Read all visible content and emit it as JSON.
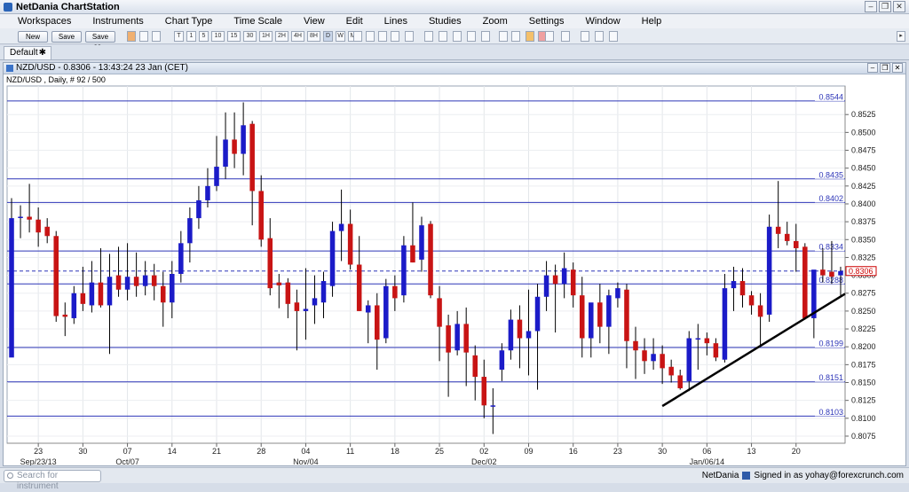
{
  "app": {
    "title": "NetDania ChartStation"
  },
  "menu": [
    "Workspaces",
    "Instruments",
    "Chart Type",
    "Time Scale",
    "View",
    "Edit",
    "Lines",
    "Studies",
    "Zoom",
    "Settings",
    "Window",
    "Help"
  ],
  "toolbar": {
    "new_label": "New",
    "save_label": "Save",
    "saveas_label": "Save as...",
    "timescales": [
      "T",
      "1",
      "5",
      "10",
      "15",
      "30",
      "1H",
      "2H",
      "4H",
      "8H",
      "D",
      "W",
      "M"
    ]
  },
  "tabs": [
    {
      "label": "Default"
    }
  ],
  "chart_window": {
    "title": "NZD/USD - 0.8306 - 13:43:24  23 Jan (CET)",
    "subtitle": "NZD/USD , Daily, # 92 / 500"
  },
  "statusbar": {
    "search_placeholder": "Search for instrument",
    "brand": "NetDania",
    "signed_in": "Signed in as yohay@forexcrunch.com"
  },
  "colors": {
    "up": "#1b1bc8",
    "down": "#c81414",
    "level_line": "#2e36b8",
    "trend_line": "#000000",
    "current_price": "#cc0000"
  },
  "chart_data": {
    "type": "candlestick",
    "symbol": "NZD/USD",
    "ylim": [
      0.807,
      0.856
    ],
    "yticks": [
      "0.8525",
      "0.8500",
      "0.8475",
      "0.8450",
      "0.8425",
      "0.8400",
      "0.8375",
      "0.8350",
      "0.8325",
      "0.8300",
      "0.8275",
      "0.8250",
      "0.8225",
      "0.8200",
      "0.8175",
      "0.8150",
      "0.8125",
      "0.8100",
      "0.8075"
    ],
    "xtick_labels": [
      {
        "i": 3,
        "top": "23",
        "bottom": "Sep/23/13"
      },
      {
        "i": 8,
        "top": "30",
        "bottom": ""
      },
      {
        "i": 13,
        "top": "07",
        "bottom": "Oct/07"
      },
      {
        "i": 18,
        "top": "14",
        "bottom": ""
      },
      {
        "i": 23,
        "top": "21",
        "bottom": ""
      },
      {
        "i": 28,
        "top": "28",
        "bottom": ""
      },
      {
        "i": 33,
        "top": "04",
        "bottom": "Nov/04"
      },
      {
        "i": 38,
        "top": "11",
        "bottom": ""
      },
      {
        "i": 43,
        "top": "18",
        "bottom": ""
      },
      {
        "i": 48,
        "top": "25",
        "bottom": ""
      },
      {
        "i": 53,
        "top": "02",
        "bottom": "Dec/02"
      },
      {
        "i": 58,
        "top": "09",
        "bottom": ""
      },
      {
        "i": 63,
        "top": "16",
        "bottom": ""
      },
      {
        "i": 68,
        "top": "23",
        "bottom": ""
      },
      {
        "i": 73,
        "top": "30",
        "bottom": ""
      },
      {
        "i": 78,
        "top": "06",
        "bottom": "Jan/06/14"
      },
      {
        "i": 83,
        "top": "13",
        "bottom": ""
      },
      {
        "i": 88,
        "top": "20",
        "bottom": ""
      }
    ],
    "hlines": [
      {
        "value": 0.8544,
        "label": "0.8544",
        "color": "#2e36b8"
      },
      {
        "value": 0.8435,
        "label": "0.8435",
        "color": "#2e36b8"
      },
      {
        "value": 0.8402,
        "label": "0.8402",
        "color": "#2e36b8"
      },
      {
        "value": 0.8334,
        "label": "0.8334",
        "color": "#2e36b8"
      },
      {
        "value": 0.8288,
        "label": "0.8288",
        "color": "#2e36b8"
      },
      {
        "value": 0.8199,
        "label": "0.8199",
        "color": "#2e36b8"
      },
      {
        "value": 0.8151,
        "label": "0.8151",
        "color": "#2e36b8"
      },
      {
        "value": 0.8103,
        "label": "0.8103",
        "color": "#2e36b8"
      }
    ],
    "current_price": {
      "value": 0.8306,
      "label": "0.8306"
    },
    "trendline": {
      "from": {
        "i": 73,
        "price": 0.8117
      },
      "to": {
        "i": 94,
        "price": 0.8278
      }
    },
    "candles": [
      [
        0.8185,
        0.8408,
        0.8208,
        0.838
      ],
      [
        0.8382,
        0.8398,
        0.8352,
        0.8382
      ],
      [
        0.8382,
        0.8428,
        0.836,
        0.8378
      ],
      [
        0.8378,
        0.8395,
        0.834,
        0.836
      ],
      [
        0.8368,
        0.838,
        0.8345,
        0.8355
      ],
      [
        0.8355,
        0.8362,
        0.8235,
        0.8243
      ],
      [
        0.8245,
        0.8262,
        0.8215,
        0.8242
      ],
      [
        0.824,
        0.8285,
        0.8232,
        0.8275
      ],
      [
        0.8275,
        0.8312,
        0.825,
        0.826
      ],
      [
        0.8258,
        0.832,
        0.8248,
        0.829
      ],
      [
        0.829,
        0.8338,
        0.8255,
        0.8258
      ],
      [
        0.8258,
        0.833,
        0.819,
        0.8298
      ],
      [
        0.83,
        0.834,
        0.827,
        0.828
      ],
      [
        0.828,
        0.8345,
        0.8265,
        0.8298
      ],
      [
        0.8298,
        0.8332,
        0.827,
        0.8285
      ],
      [
        0.8285,
        0.832,
        0.8272,
        0.83
      ],
      [
        0.83,
        0.8316,
        0.8265,
        0.8285
      ],
      [
        0.8285,
        0.8305,
        0.8228,
        0.8262
      ],
      [
        0.8262,
        0.832,
        0.824,
        0.8302
      ],
      [
        0.8302,
        0.8362,
        0.829,
        0.8345
      ],
      [
        0.8345,
        0.8395,
        0.8318,
        0.838
      ],
      [
        0.838,
        0.8425,
        0.8365,
        0.8405
      ],
      [
        0.8405,
        0.845,
        0.8395,
        0.8425
      ],
      [
        0.8425,
        0.8495,
        0.8418,
        0.8452
      ],
      [
        0.8452,
        0.8528,
        0.8435,
        0.849
      ],
      [
        0.849,
        0.8528,
        0.845,
        0.847
      ],
      [
        0.847,
        0.8542,
        0.844,
        0.851
      ],
      [
        0.8512,
        0.8516,
        0.837,
        0.8418
      ],
      [
        0.8418,
        0.844,
        0.834,
        0.835
      ],
      [
        0.8352,
        0.838,
        0.8272,
        0.8282
      ],
      [
        0.829,
        0.8302,
        0.8254,
        0.8286
      ],
      [
        0.829,
        0.8296,
        0.824,
        0.826
      ],
      [
        0.8262,
        0.828,
        0.8195,
        0.825
      ],
      [
        0.825,
        0.831,
        0.821,
        0.8253
      ],
      [
        0.8258,
        0.83,
        0.8232,
        0.8268
      ],
      [
        0.8262,
        0.8305,
        0.824,
        0.8292
      ],
      [
        0.8285,
        0.8375,
        0.827,
        0.8362
      ],
      [
        0.8362,
        0.842,
        0.832,
        0.8372
      ],
      [
        0.8372,
        0.8392,
        0.8308,
        0.8315
      ],
      [
        0.8315,
        0.8355,
        0.825,
        0.825
      ],
      [
        0.8248,
        0.8265,
        0.8205,
        0.8258
      ],
      [
        0.8258,
        0.8275,
        0.8168,
        0.821
      ],
      [
        0.8212,
        0.8295,
        0.8205,
        0.8285
      ],
      [
        0.8285,
        0.83,
        0.825,
        0.8268
      ],
      [
        0.8272,
        0.8355,
        0.8262,
        0.8342
      ],
      [
        0.8342,
        0.8402,
        0.8318,
        0.8318
      ],
      [
        0.8322,
        0.8382,
        0.8305,
        0.837
      ],
      [
        0.8372,
        0.8376,
        0.8268,
        0.8272
      ],
      [
        0.8268,
        0.8285,
        0.818,
        0.8228
      ],
      [
        0.823,
        0.8245,
        0.813,
        0.8192
      ],
      [
        0.8195,
        0.825,
        0.8188,
        0.8232
      ],
      [
        0.8232,
        0.8255,
        0.8145,
        0.8192
      ],
      [
        0.8188,
        0.8202,
        0.8125,
        0.8158
      ],
      [
        0.8158,
        0.8182,
        0.81,
        0.8118
      ],
      [
        0.8118,
        0.8142,
        0.8078,
        0.8118
      ],
      [
        0.8168,
        0.8205,
        0.8152,
        0.8195
      ],
      [
        0.8195,
        0.8252,
        0.8182,
        0.8238
      ],
      [
        0.8238,
        0.8258,
        0.817,
        0.8212
      ],
      [
        0.8212,
        0.828,
        0.816,
        0.8222
      ],
      [
        0.8222,
        0.8288,
        0.814,
        0.827
      ],
      [
        0.827,
        0.832,
        0.825,
        0.83
      ],
      [
        0.83,
        0.8315,
        0.822,
        0.8288
      ],
      [
        0.8288,
        0.8332,
        0.8268,
        0.831
      ],
      [
        0.8308,
        0.8318,
        0.8255,
        0.8272
      ],
      [
        0.8272,
        0.8298,
        0.8185,
        0.8212
      ],
      [
        0.8212,
        0.825,
        0.8185,
        0.8262
      ],
      [
        0.8262,
        0.8288,
        0.8205,
        0.8228
      ],
      [
        0.8228,
        0.828,
        0.819,
        0.8272
      ],
      [
        0.8268,
        0.829,
        0.8255,
        0.8282
      ],
      [
        0.828,
        0.8288,
        0.817,
        0.8208
      ],
      [
        0.8208,
        0.8228,
        0.8155,
        0.8195
      ],
      [
        0.8195,
        0.8212,
        0.8162,
        0.818
      ],
      [
        0.818,
        0.8212,
        0.8168,
        0.819
      ],
      [
        0.819,
        0.8202,
        0.8148,
        0.817
      ],
      [
        0.8172,
        0.8182,
        0.815,
        0.816
      ],
      [
        0.816,
        0.8168,
        0.814,
        0.8142
      ],
      [
        0.8152,
        0.8222,
        0.8138,
        0.8212
      ],
      [
        0.8212,
        0.8232,
        0.8168,
        0.8212
      ],
      [
        0.8212,
        0.822,
        0.8188,
        0.8205
      ],
      [
        0.8205,
        0.8212,
        0.818,
        0.8185
      ],
      [
        0.8182,
        0.8302,
        0.8178,
        0.8282
      ],
      [
        0.8282,
        0.8312,
        0.825,
        0.8292
      ],
      [
        0.8292,
        0.831,
        0.8255,
        0.8272
      ],
      [
        0.8272,
        0.8278,
        0.8245,
        0.8258
      ],
      [
        0.8258,
        0.8275,
        0.82,
        0.8242
      ],
      [
        0.8245,
        0.8385,
        0.8235,
        0.8368
      ],
      [
        0.8368,
        0.8432,
        0.8338,
        0.8358
      ],
      [
        0.8358,
        0.8375,
        0.8342,
        0.8348
      ],
      [
        0.8348,
        0.8372,
        0.8305,
        0.8338
      ],
      [
        0.834,
        0.8345,
        0.8238,
        0.824
      ],
      [
        0.824,
        0.8292,
        0.8212,
        0.8308
      ],
      [
        0.8308,
        0.8338,
        0.829,
        0.83
      ],
      [
        0.8305,
        0.8348,
        0.8288,
        0.8298
      ],
      [
        0.83,
        0.8312,
        0.827,
        0.8306
      ]
    ]
  }
}
